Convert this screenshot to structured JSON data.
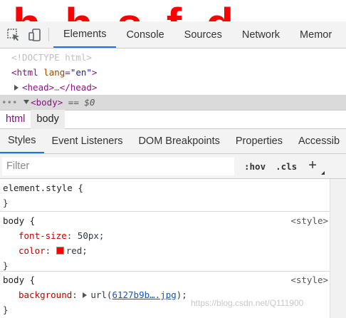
{
  "page": {
    "large_text": "hhsfd"
  },
  "toolbar": {
    "tabs": [
      "Elements",
      "Console",
      "Sources",
      "Network",
      "Memor"
    ]
  },
  "dom": {
    "doctype": "<!DOCTYPE html>",
    "html_open": "<html",
    "lang_attr": "lang",
    "lang_val": "\"en\"",
    "gt": ">",
    "head_open": "<head>",
    "ellipsis": "…",
    "head_close": "</head>",
    "body_open": "<body>",
    "dollar_zero": "== $0"
  },
  "breadcrumb": {
    "items": [
      "html",
      "body"
    ]
  },
  "sidebar": {
    "tabs": [
      "Styles",
      "Event Listeners",
      "DOM Breakpoints",
      "Properties",
      "Accessib"
    ]
  },
  "filter": {
    "placeholder": "Filter",
    "hov_label": ":hov",
    "cls_label": ".cls",
    "add_label": "+"
  },
  "rules": [
    {
      "selector": "element.style {",
      "close": "}"
    },
    {
      "selector": "body {",
      "source": "<style>",
      "props": [
        {
          "name": "font-size",
          "value": "50px;"
        },
        {
          "name": "color",
          "value": "red;"
        }
      ],
      "close": "}"
    },
    {
      "selector": "body {",
      "source": "<style>",
      "props": [
        {
          "name": "background",
          "value_prefix": "url(",
          "link": "6127b9b….jpg",
          "value_suffix": ");"
        }
      ],
      "close": "}"
    }
  ],
  "colors": {
    "accent": "#1a73e8",
    "tag": "#881280",
    "prop_name": "#c80000",
    "swatch_red": "#ff0000"
  },
  "watermark": "https://blog.csdn.net/Q111900"
}
